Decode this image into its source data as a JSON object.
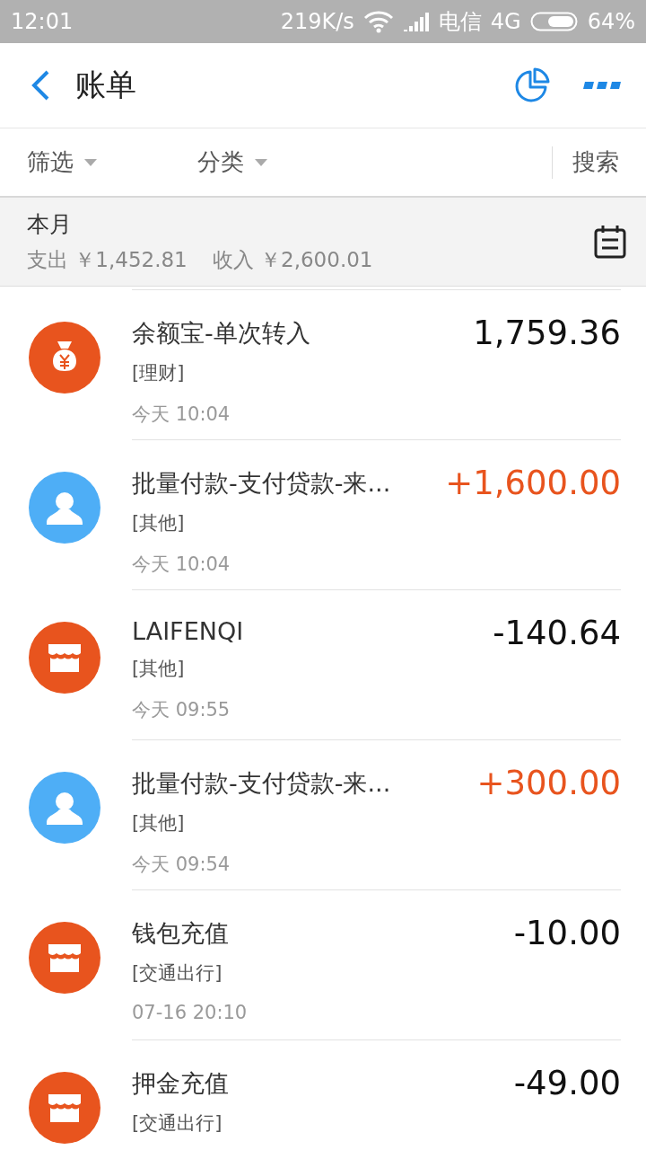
{
  "status_bar": {
    "time": "12:01",
    "speed": "219K/s",
    "carrier": "电信",
    "network": "4G",
    "battery": "64%"
  },
  "header": {
    "title": "账单"
  },
  "filters": [
    {
      "label": "筛选"
    },
    {
      "label": "分类"
    }
  ],
  "search": {
    "label": "搜索"
  },
  "summary": {
    "period": "本月",
    "expense": "支出 ￥1,452.81",
    "income": "收入 ￥2,600.01"
  },
  "transactions": [
    {
      "kind": "money-bag",
      "title": "余额宝-单次转入",
      "category": "[理财]",
      "time": "今天  10:04",
      "amount": "1,759.36",
      "income": false
    },
    {
      "kind": "person",
      "title": "批量付款-支付贷款-来...",
      "category": "[其他]",
      "time": "今天  10:04",
      "amount": "+1,600.00",
      "income": true
    },
    {
      "kind": "store",
      "title": "LAIFENQI",
      "category": "[其他]",
      "time": "今天  09:55",
      "amount": "-140.64",
      "income": false
    },
    {
      "kind": "person",
      "title": "批量付款-支付贷款-来...",
      "category": "[其他]",
      "time": "今天  09:54",
      "amount": "+300.00",
      "income": true
    },
    {
      "kind": "store",
      "title": "钱包充值",
      "category": "[交通出行]",
      "time": "07-16  20:10",
      "amount": "-10.00",
      "income": false
    },
    {
      "kind": "store",
      "title": "押金充值",
      "category": "[交通出行]",
      "amount": "-49.00",
      "income": false
    }
  ]
}
